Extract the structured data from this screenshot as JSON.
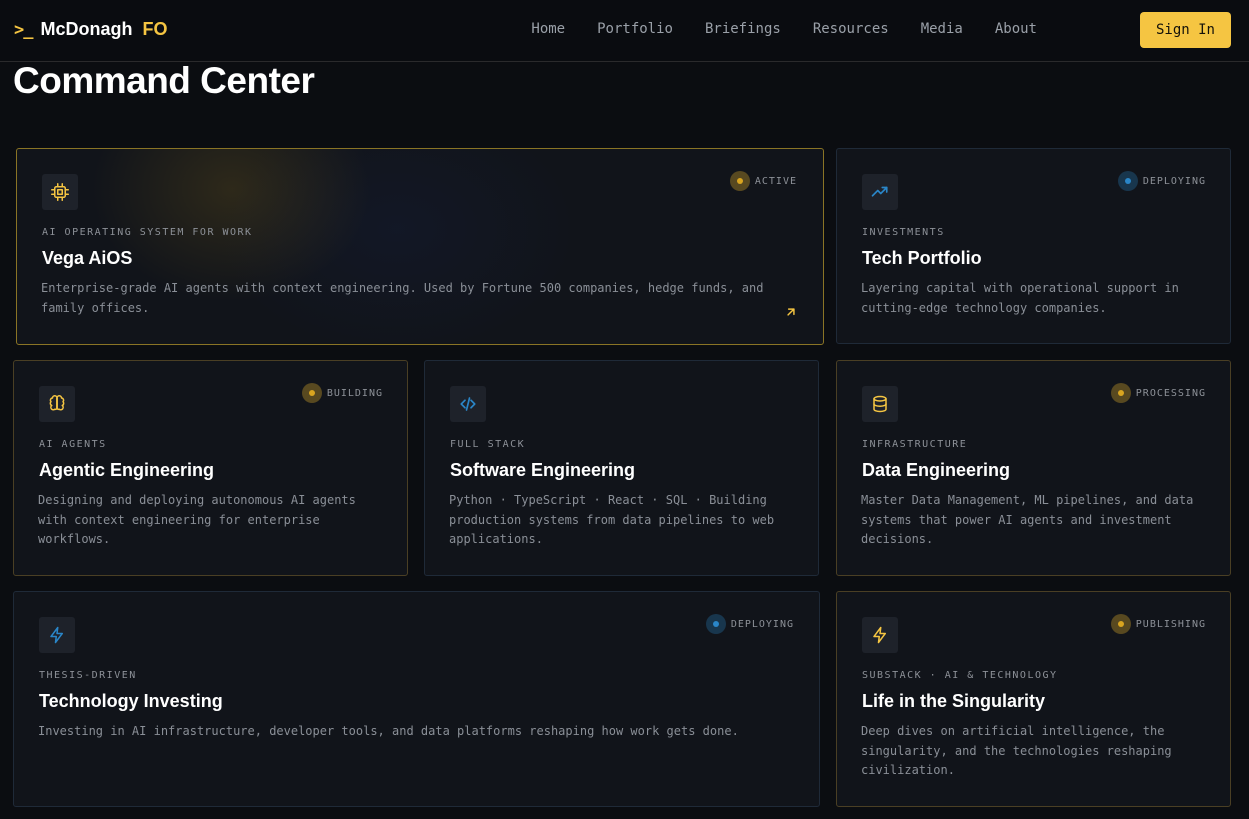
{
  "nav": {
    "logo_prompt": ">_",
    "logo_name": "McDonagh",
    "logo_suffix": "FO",
    "links": [
      "Home",
      "Portfolio",
      "Briefings",
      "Resources",
      "Media",
      "About"
    ],
    "signin_label": "Sign In"
  },
  "page": {
    "title": "Command Center"
  },
  "colors": {
    "accent_gold": "#f5c542",
    "accent_blue": "#2a86c8",
    "background": "#0b0d11"
  },
  "cards": [
    {
      "status": "ACTIVE",
      "status_color": "gold",
      "icon": "cpu-icon",
      "kicker": "AI OPERATING SYSTEM FOR WORK",
      "title": "Vega AiOS",
      "desc": "Enterprise-grade AI agents with context engineering. Used by Fortune 500 companies, hedge funds, and family offices.",
      "link_icon": "arrow-up-right-icon"
    },
    {
      "status": "DEPLOYING",
      "status_color": "blue",
      "icon": "trending-up-icon",
      "kicker": "INVESTMENTS",
      "title": "Tech Portfolio",
      "desc": "Layering capital with operational support in cutting-edge technology companies."
    },
    {
      "status": "BUILDING",
      "status_color": "gold",
      "icon": "brain-icon",
      "kicker": "AI AGENTS",
      "title": "Agentic Engineering",
      "desc": "Designing and deploying autonomous AI agents with context engineering for enterprise workflows."
    },
    {
      "status": "",
      "status_color": "blue",
      "icon": "code-icon",
      "kicker": "FULL STACK",
      "title": "Software Engineering",
      "desc": "Python · TypeScript · React · SQL · Building production systems from data pipelines to web applications."
    },
    {
      "status": "PROCESSING",
      "status_color": "gold",
      "icon": "database-icon",
      "kicker": "INFRASTRUCTURE",
      "title": "Data Engineering",
      "desc": "Master Data Management, ML pipelines, and data systems that power AI agents and investment decisions."
    },
    {
      "status": "DEPLOYING",
      "status_color": "blue",
      "icon": "lightning-icon",
      "kicker": "THESIS-DRIVEN",
      "title": "Technology Investing",
      "desc": "Investing in AI infrastructure, developer tools, and data platforms reshaping how work gets done."
    },
    {
      "status": "PUBLISHING",
      "status_color": "gold",
      "icon": "lightning-icon",
      "kicker": "SUBSTACK · AI & TECHNOLOGY",
      "title": "Life in the Singularity",
      "desc": "Deep dives on artificial intelligence, the singularity, and the technologies reshaping civilization."
    }
  ]
}
